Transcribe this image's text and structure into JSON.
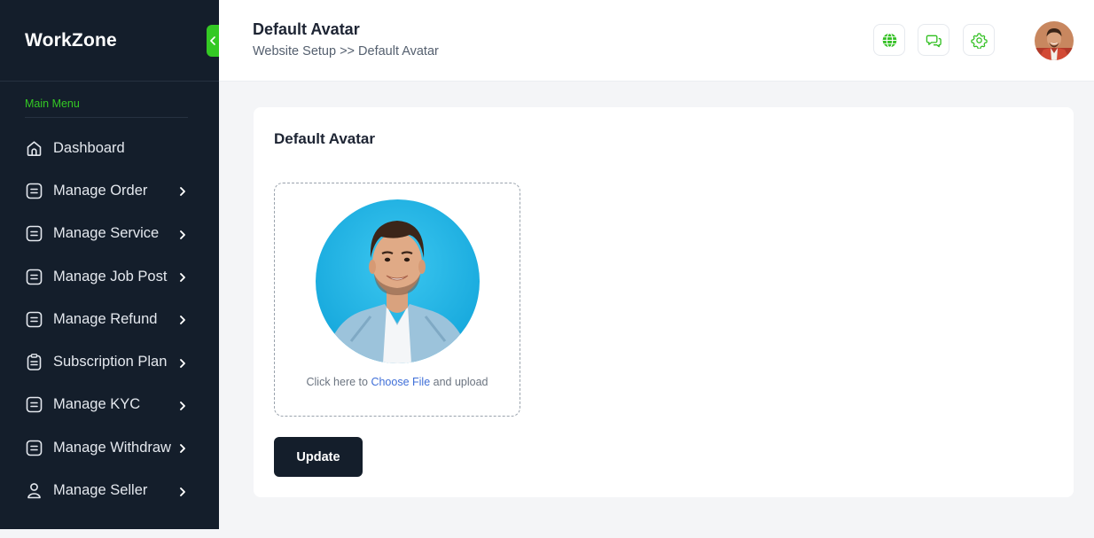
{
  "brand": {
    "name": "WorkZone"
  },
  "sidebar": {
    "heading": "Main Menu",
    "items": [
      {
        "label": "Dashboard",
        "icon": "home-icon",
        "chevron": false
      },
      {
        "label": "Manage Order",
        "icon": "list-icon",
        "chevron": true
      },
      {
        "label": "Manage Service",
        "icon": "list-icon",
        "chevron": true
      },
      {
        "label": "Manage Job Post",
        "icon": "list-icon",
        "chevron": true
      },
      {
        "label": "Manage Refund",
        "icon": "list-icon",
        "chevron": true
      },
      {
        "label": "Subscription Plan",
        "icon": "clipboard-icon",
        "chevron": true
      },
      {
        "label": "Manage KYC",
        "icon": "list-icon",
        "chevron": true
      },
      {
        "label": "Manage Withdraw",
        "icon": "list-icon",
        "chevron": true
      },
      {
        "label": "Manage Seller",
        "icon": "user-icon",
        "chevron": true
      }
    ]
  },
  "header": {
    "title": "Default Avatar",
    "breadcrumb": "Website Setup >> Default Avatar",
    "icons": [
      "globe-icon",
      "chat-icon",
      "gear-icon"
    ]
  },
  "main": {
    "card_title": "Default Avatar",
    "upload_hint_before": "Click here to ",
    "upload_hint_link": "Choose File",
    "upload_hint_after": " and upload",
    "update_label": "Update"
  },
  "colors": {
    "sidebar_bg": "#141e2b",
    "accent_green": "#34c924",
    "link_blue": "#3f6fd8",
    "button_dark": "#141e2b"
  }
}
